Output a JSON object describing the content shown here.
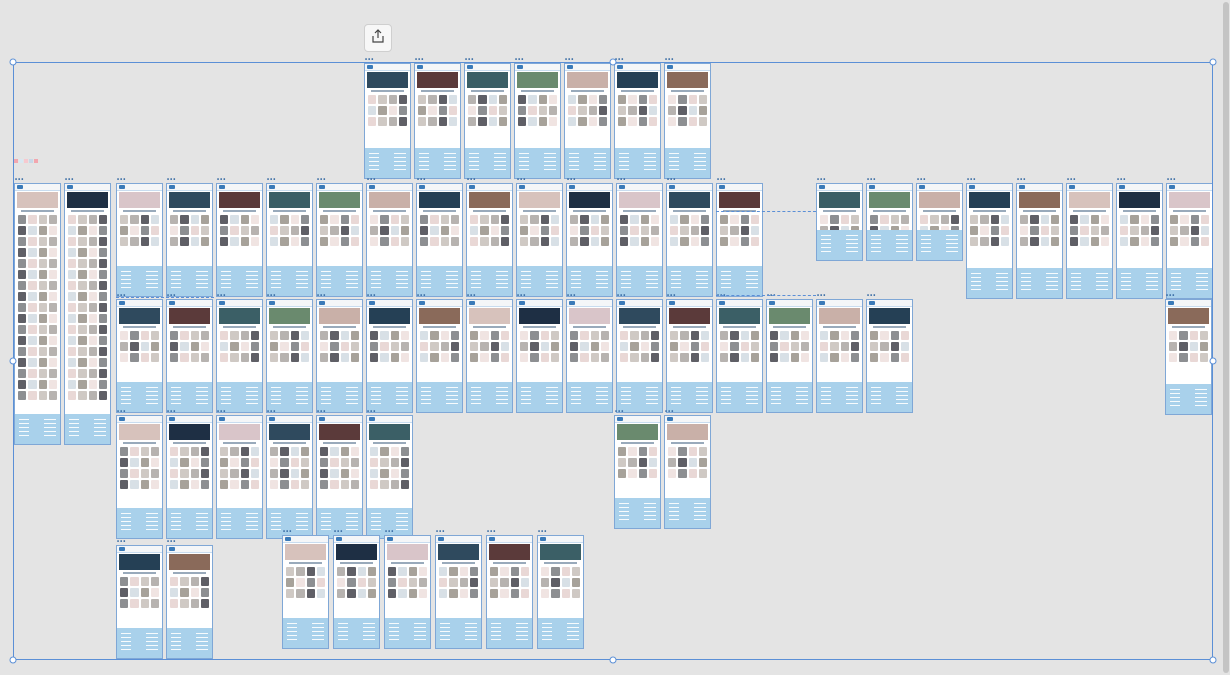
{
  "toolbar": {
    "share_icon": "share-export-icon"
  },
  "artboards": {
    "label": "•••"
  },
  "colors": {
    "canvas": "#e4e4e4",
    "selection": "#5b8fd6",
    "artboard_border": "#7fa7d6",
    "footer": "#a9d1eb",
    "hero": [
      "#2f4a5e",
      "#5b3a3a",
      "#3b5f66",
      "#6a8a6e",
      "#c9b0a8",
      "#254055",
      "#8a6a5a",
      "#d7c2bc",
      "#1e2f44",
      "#d9c5c9"
    ],
    "tiles": [
      "#e9d8d6",
      "#cfc9c4",
      "#b7b3b0",
      "#5f5f66",
      "#d8e0e6",
      "#a7a29a",
      "#f0e4e2",
      "#8d8f92"
    ]
  }
}
